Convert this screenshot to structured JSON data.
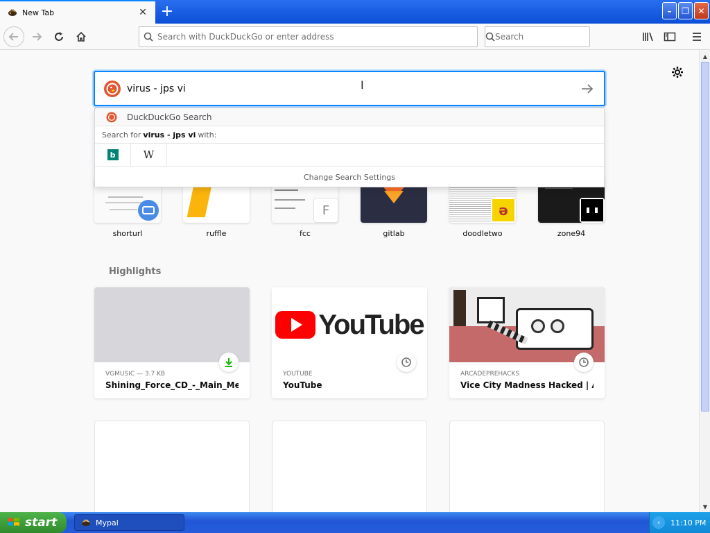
{
  "browser": {
    "tab": {
      "title": "New Tab"
    },
    "urlbar": {
      "placeholder": "Search with DuckDuckGo or enter address"
    },
    "searchbar": {
      "placeholder": "Search"
    }
  },
  "content_search": {
    "value": "virus - jps vi",
    "suggestions": {
      "engine_item": "DuckDuckGo Search",
      "search_for_prefix": "Search for",
      "search_for_term": "virus - jps vi",
      "search_for_suffix": "with:",
      "engines": [
        "bing",
        "wikipedia"
      ],
      "engine_glyphs": {
        "bing": "b",
        "wikipedia": "W"
      },
      "change_settings": "Change Search Settings"
    }
  },
  "top_sites": [
    {
      "label": "shorturl"
    },
    {
      "label": "ruffle"
    },
    {
      "label": "fcc",
      "badge_letter": "F"
    },
    {
      "label": "gitlab"
    },
    {
      "label": "doodletwo"
    },
    {
      "label": "zone94"
    }
  ],
  "highlights": {
    "title": "Highlights",
    "cards": [
      {
        "source": "VGMUSIC — 3.7 KB",
        "title": "Shining_Force_CD_-_Main_Menu....",
        "badge": "download-icon"
      },
      {
        "source": "YOUTUBE",
        "title": "YouTube",
        "badge": "clock-icon",
        "logo_text": "YouTube"
      },
      {
        "source": "ARCADEPREHACKS",
        "title": "Vice City Madness Hacked | Arca...",
        "badge": "clock-icon"
      }
    ]
  },
  "taskbar": {
    "start_label": "start",
    "task_label": "Mypal",
    "clock": "11:10 PM"
  },
  "colors": {
    "accent": "#0a84ff",
    "taskbar": "#245ddb",
    "start": "#3c9a38"
  }
}
